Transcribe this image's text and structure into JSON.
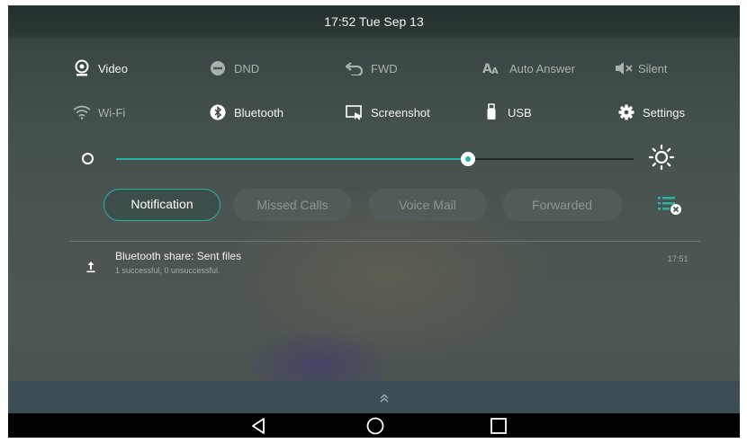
{
  "status_bar": {
    "clock": "17:52 Tue Sep 13"
  },
  "quick_settings": {
    "row1": [
      {
        "label": "Video",
        "icon": "video-camera-icon",
        "enabled": true
      },
      {
        "label": "DND",
        "icon": "dnd-icon",
        "enabled": false
      },
      {
        "label": "FWD",
        "icon": "forward-arrow-icon",
        "enabled": false
      },
      {
        "label": "Auto Answer",
        "icon": "auto-answer-icon",
        "enabled": false
      },
      {
        "label": "Silent",
        "icon": "speaker-mute-icon",
        "enabled": false
      }
    ],
    "row2": [
      {
        "label": "Wi-Fi",
        "icon": "wifi-icon",
        "enabled": false
      },
      {
        "label": "Bluetooth",
        "icon": "bluetooth-icon",
        "enabled": true
      },
      {
        "label": "Screenshot",
        "icon": "screenshot-icon",
        "enabled": true
      },
      {
        "label": "USB",
        "icon": "usb-icon",
        "enabled": true
      },
      {
        "label": "Settings",
        "icon": "gear-icon",
        "enabled": true
      }
    ]
  },
  "brightness": {
    "level_fraction": 0.68,
    "accent": "#26b3a3"
  },
  "tabs": [
    {
      "label": "Notification",
      "active": true
    },
    {
      "label": "Missed Calls",
      "active": false
    },
    {
      "label": "Voice Mail",
      "active": false
    },
    {
      "label": "Forwarded",
      "active": false
    }
  ],
  "notifications": [
    {
      "icon": "upload-icon",
      "title": "Bluetooth share: Sent files",
      "subtitle": "1 successful, 0 unsuccessful.",
      "time": "17:51"
    }
  ],
  "nav": {
    "back_icon": "back-triangle-icon",
    "home_icon": "home-circle-icon",
    "recents_icon": "recents-square-icon"
  },
  "colors": {
    "accent": "#26b3a3",
    "navbar": "#000000",
    "handle_bar": "#3d4d55"
  }
}
